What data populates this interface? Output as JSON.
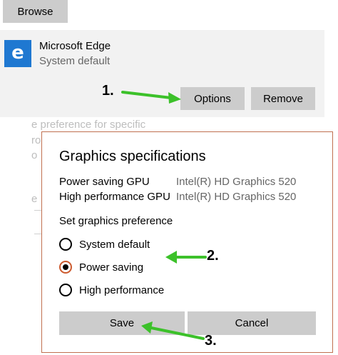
{
  "browse_button": "Browse",
  "app": {
    "name": "Microsoft Edge",
    "subtitle": "System default",
    "icon": "edge-e-icon",
    "icon_letter": "e",
    "options_label": "Options",
    "remove_label": "Remove"
  },
  "background_text": {
    "line1": "e preference for specific",
    "frag1": "ro",
    "frag2": "o",
    "frag3": "e"
  },
  "dialog": {
    "title": "Graphics specifications",
    "specs": [
      {
        "label": "Power saving GPU",
        "value": "Intel(R) HD Graphics 520"
      },
      {
        "label": "High performance GPU",
        "value": "Intel(R) HD Graphics 520"
      }
    ],
    "preference_label": "Set graphics preference",
    "options": [
      {
        "label": "System default",
        "selected": false
      },
      {
        "label": "Power saving",
        "selected": true
      },
      {
        "label": "High performance",
        "selected": false
      }
    ],
    "save_label": "Save",
    "cancel_label": "Cancel"
  },
  "annotations": [
    "1.",
    "2.",
    "3."
  ],
  "colors": {
    "annotation_arrow": "#3cc12a",
    "edge_blue": "#1f78d1",
    "selected_radio_ring": "#cc5a2e",
    "dialog_border": "#c07050"
  }
}
